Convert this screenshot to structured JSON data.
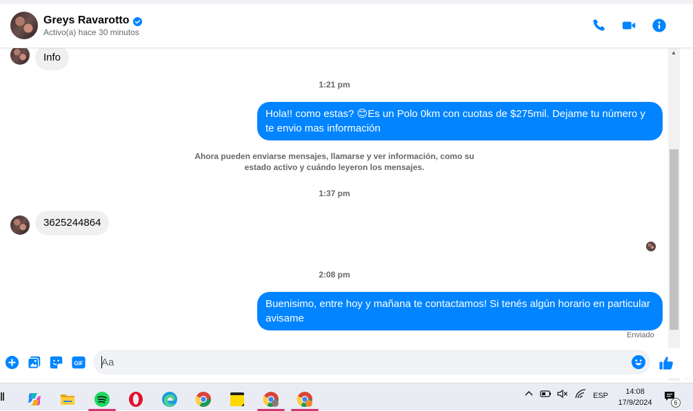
{
  "header": {
    "name": "Greys Ravarotto",
    "status": "Activo(a) hace 30 minutos",
    "icons": [
      "phone-icon",
      "video-camera-icon",
      "info-icon"
    ],
    "accent": "#0084ff"
  },
  "messages": {
    "first_incoming": "Info",
    "time_1": "1:21 pm",
    "outgoing_1": "Hola!! como estas? 😊Es un Polo 0km con cuotas de $275mil. Dejame tu número y te envio mas información",
    "notice": "Ahora pueden enviarse mensajes, llamarse y ver información, como su estado activo y cuándo leyeron los mensajes.",
    "time_2": "1:37 pm",
    "incoming_2": "3625244864",
    "time_3": "2:08 pm",
    "outgoing_2": "Buenisimo, entre hoy y mañana te contactamos! Si tenés algún horario en particular avisame",
    "sent_status": "Enviado"
  },
  "composer": {
    "placeholder": "Aa",
    "icons": [
      "plus-icon",
      "image-icon",
      "sticker-icon",
      "gif-icon",
      "emoji-icon",
      "thumbs-up-icon"
    ],
    "gif_label": "GIF"
  },
  "taskbar": {
    "apps": [
      "copilot-icon",
      "file-explorer-icon",
      "spotify-icon",
      "opera-icon",
      "edge-icon",
      "chrome-icon",
      "sticky-notes-icon",
      "chrome-profile-icon",
      "chrome-profile-2-icon"
    ],
    "language": "ESP",
    "time": "14:08",
    "date": "17/9/2024",
    "notifications": "6"
  }
}
